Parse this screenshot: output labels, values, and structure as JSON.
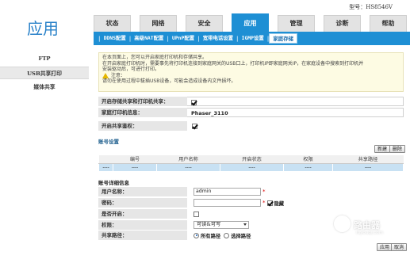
{
  "header": {
    "app_title": "应用",
    "model": "型号：HS8546V"
  },
  "main_tabs": [
    {
      "label": "状态",
      "active": false
    },
    {
      "label": "网络",
      "active": false
    },
    {
      "label": "安全",
      "active": false
    },
    {
      "label": "应用",
      "active": true
    },
    {
      "label": "管理",
      "active": false
    },
    {
      "label": "诊断",
      "active": false
    },
    {
      "label": "帮助",
      "active": false
    }
  ],
  "sub_tabs": [
    {
      "label": "DDNS配置",
      "active": false
    },
    {
      "label": "高级NAT配置",
      "active": false
    },
    {
      "label": "UPnP配置",
      "active": false
    },
    {
      "label": "宽带电话设置",
      "active": false
    },
    {
      "label": "IGMP设置",
      "active": false
    },
    {
      "label": "家庭存储",
      "active": true
    }
  ],
  "sidebar": {
    "items": [
      {
        "label": "FTP",
        "active": false
      },
      {
        "label": "USB共享打印",
        "active": true
      },
      {
        "label": "媒体共享",
        "active": false
      }
    ]
  },
  "notice": {
    "line1": "在本页面上，您可以开启家庭打印机和存储共享。",
    "line2": "在开启家庭打印机时，需要事先将打印机连接到家庭网关的USB口上，打印机IP即家庭网关IP，在家庭设备中搜索到打印机并",
    "line3": "安装驱动后，可进行打印。",
    "warning_title": "注意：",
    "warning_text": "请勿在使用过程中拔插USB设备，可能会造成设备内文件损坏。"
  },
  "form": {
    "enable_share_label": "开启存储共享和打印机共享：",
    "enable_share_checked": true,
    "printer_info_label": "家庭打印机信息：",
    "printer_info_value": "Phaser_3110",
    "enable_auth_label": "开启共享鉴权：",
    "enable_auth_checked": true
  },
  "account_settings": {
    "title": "账号设置",
    "new_button": "新建",
    "delete_button": "删除",
    "columns": [
      "",
      "编号",
      "用户名称",
      "开启状态",
      "权限",
      "共享路径"
    ],
    "rows": [
      [
        "----",
        "----",
        "----",
        "----",
        "----",
        "----"
      ]
    ]
  },
  "account_detail": {
    "title": "账号详细信息",
    "username_label": "用户名称：",
    "username_value": "admin",
    "password_label": "密码：",
    "password_value": "",
    "hide_label": "隐藏",
    "hide_checked": true,
    "enabled_label": "是否开启：",
    "enabled_checked": false,
    "permission_label": "权限：",
    "permission_value": "可读&可写",
    "share_path_label": "共享路径：",
    "share_all_label": "所有路径",
    "share_select_label": "选择路径",
    "share_mode": "all",
    "apply_button": "应用",
    "cancel_button": "取消"
  },
  "watermark": {
    "title": "路由器",
    "subtitle": "luyouqi.com"
  }
}
